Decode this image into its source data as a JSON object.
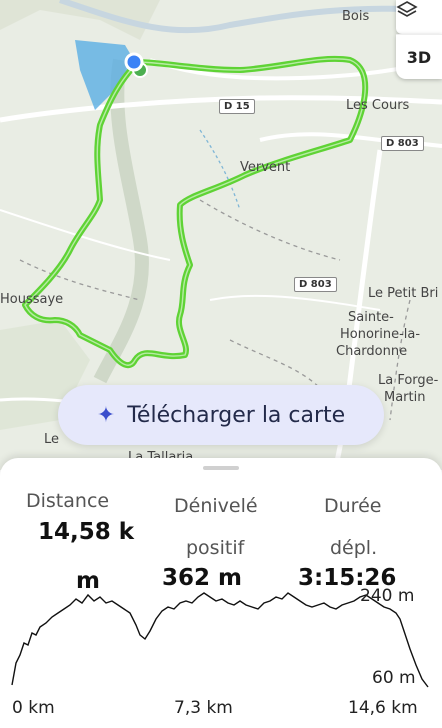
{
  "map": {
    "places": {
      "bois": "Bois",
      "les_cours": "Les Cours",
      "vervent": "Vervent",
      "petit_bri": "Le Petit Bri",
      "sainte": "Sainte-",
      "honorine": "Honorine-la-",
      "chardonne": "Chardonne",
      "forge": "La Forge-",
      "martin": "Martin",
      "houssaye": "Houssaye",
      "le": "Le",
      "tallaria": "La Tallaria"
    },
    "roads": {
      "d15": "D 15",
      "d803a": "D 803",
      "d803b": "D 803"
    },
    "controls": {
      "layers_icon": "layers-icon",
      "btn_3d": "3D"
    },
    "download_label": "Télécharger la carte",
    "colors": {
      "route": "#5fd335",
      "water": "#5aaee4",
      "location": "#3b82f6"
    }
  },
  "stats": {
    "distance_label": "Distance",
    "distance_value": "14,58 k",
    "distance_cut": "m",
    "elevation_label_1": "Dénivelé",
    "elevation_label_2": "positif",
    "elevation_value": "362 m",
    "duration_label_1": "Durée",
    "duration_label_2": "dépl.",
    "duration_value": "3:15:26"
  },
  "profile": {
    "y_max_label": "240 m",
    "y_min_label": "60 m",
    "x_start": "0 km",
    "x_mid": "7,3 km",
    "x_end": "14,6 km"
  }
}
